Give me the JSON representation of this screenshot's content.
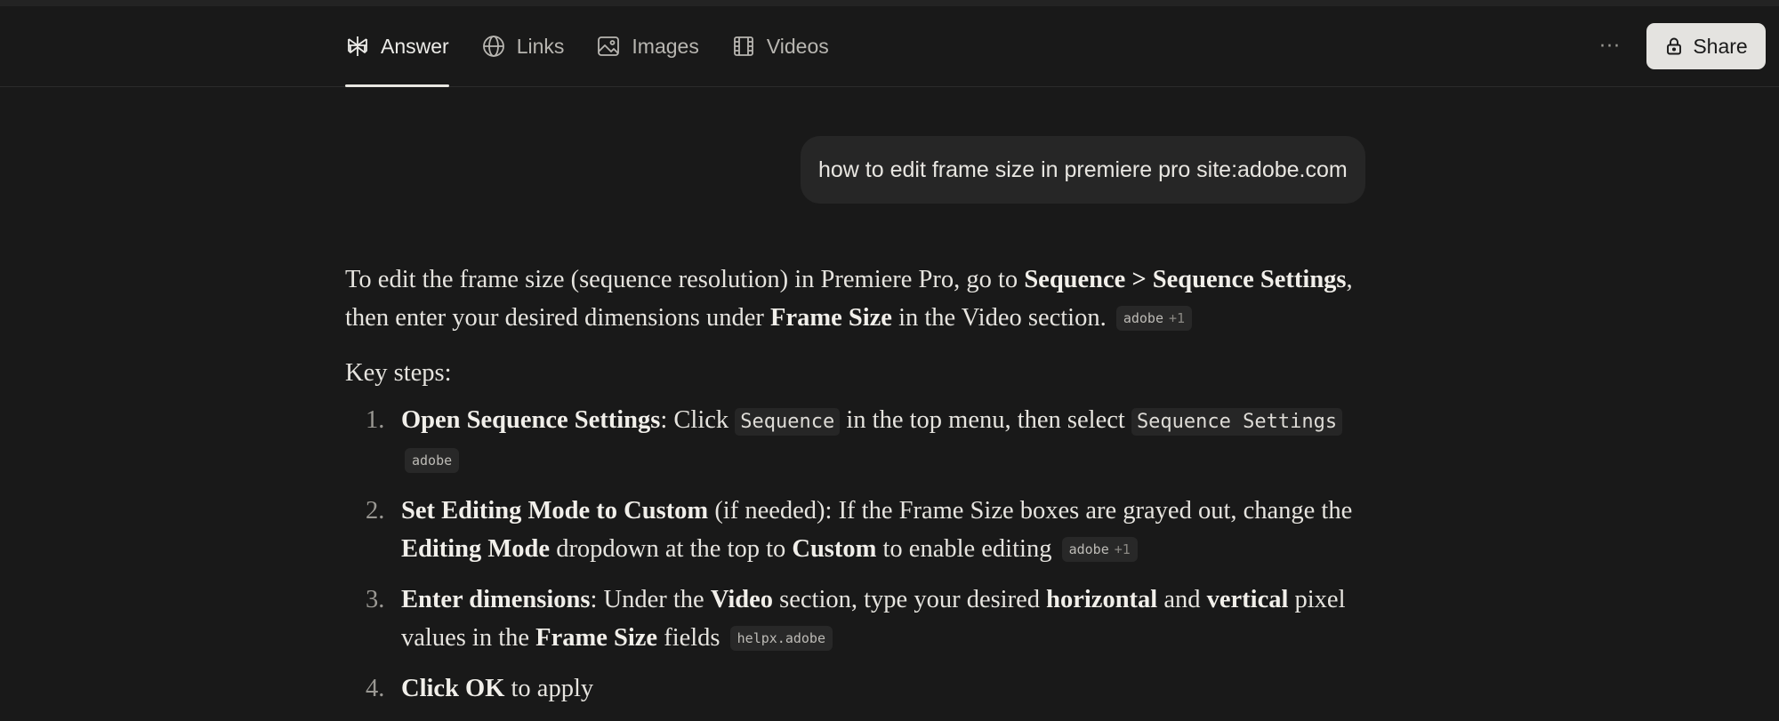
{
  "tabs": [
    {
      "label": "Answer",
      "icon": "perplexity-logo-icon",
      "active": true
    },
    {
      "label": "Links",
      "icon": "globe-icon",
      "active": false
    },
    {
      "label": "Images",
      "icon": "image-icon",
      "active": false
    },
    {
      "label": "Videos",
      "icon": "film-icon",
      "active": false
    }
  ],
  "header": {
    "more_label": "···",
    "share_label": "Share"
  },
  "query": "how to edit frame size in premiere pro site:adobe.com",
  "answer": {
    "intro": {
      "t1": "To edit the frame size (sequence resolution) in Premiere Pro, go to ",
      "b1": "Sequence > Sequence Settings",
      "t2": ", then enter your desired dimensions under ",
      "b2": "Frame Size",
      "t3": " in the Video section.",
      "cite": {
        "source": "adobe",
        "more": "+1"
      }
    },
    "key_steps_label": "Key steps:",
    "steps": [
      {
        "num": "1.",
        "bold": "Open Sequence Settings",
        "t1": ": Click ",
        "code1": "Sequence",
        "t2": " in the top menu, then select ",
        "code2": "Sequence Settings",
        "cite": {
          "source": "adobe"
        }
      },
      {
        "num": "2.",
        "bold": "Set Editing Mode to Custom",
        "t1": " (if needed): If the Frame Size boxes are grayed out, change the ",
        "b2": "Editing Mode",
        "t2": " dropdown at the top to ",
        "b3": "Custom",
        "t3": " to enable editing",
        "cite": {
          "source": "adobe",
          "more": "+1"
        }
      },
      {
        "num": "3.",
        "bold": "Enter dimensions",
        "t1": ": Under the ",
        "b2": "Video",
        "t2": " section, type your desired ",
        "b3": "horizontal",
        "t3": " and ",
        "b4": "vertical",
        "t4": " pixel values in the ",
        "b5": "Frame Size",
        "t5": " fields",
        "cite": {
          "source": "helpx.adobe"
        }
      },
      {
        "num": "4.",
        "bold": "Click OK",
        "t1": " to apply"
      }
    ]
  },
  "colors": {
    "background": "#191919",
    "text": "#e6e4df",
    "share_button_bg": "#e4e3e0",
    "query_bubble_bg": "#262626"
  }
}
